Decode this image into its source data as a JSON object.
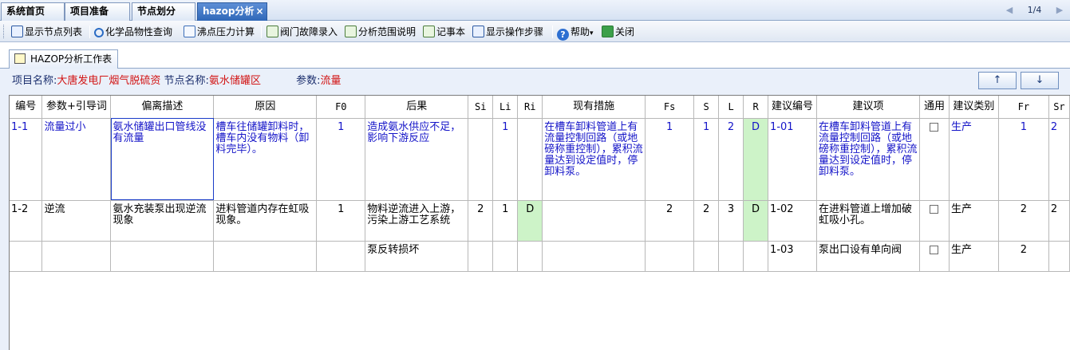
{
  "tabs": [
    {
      "label": "系统首页"
    },
    {
      "label": "项目准备"
    },
    {
      "label": "节点划分"
    },
    {
      "label": "hazop分析",
      "close": "×"
    }
  ],
  "pager": {
    "prev": "◀",
    "page": "1/4",
    "next": "▶"
  },
  "toolbar": {
    "show_nodes": "显示节点列表",
    "chem_query": "化学品物性查询",
    "boiling_calc": "沸点压力计算",
    "valve_fault": "阀门故障录入",
    "scope_desc": "分析范围说明",
    "notebook": "记事本",
    "show_steps": "显示操作步骤",
    "help": "帮助",
    "help_caret": "▾",
    "close": "关闭"
  },
  "panel": {
    "tab_label": "HAZOP分析工作表"
  },
  "info": {
    "project_label": "项目名称:",
    "project_value": "大唐发电厂烟气脱硫资",
    "node_label": "节点名称:",
    "node_value": "氨水储罐区",
    "param_label": "参数:",
    "param_value": "流量"
  },
  "nav": {
    "up": "↑",
    "down": "↓"
  },
  "grid": {
    "headers": [
      "编号",
      "参数+引导词",
      "偏离描述",
      "原因",
      "F0",
      "后果",
      "Si",
      "Li",
      "Ri",
      "现有措施",
      "Fs",
      "S",
      "L",
      "R",
      "建议编号",
      "建议项",
      "通用",
      "建议类别",
      "Fr",
      "Sr"
    ],
    "rows": [
      {
        "id": "1-1",
        "param": "流量过小",
        "deviation": "氨水储罐出口管线没有流量",
        "cause": "槽车往储罐卸料时，槽车内没有物料（卸料完毕）。",
        "f0": "1",
        "consequence": "造成氨水供应不足，影响下游反应",
        "si": "",
        "li": "1",
        "ri": "",
        "measures": "在槽车卸料管道上有流量控制回路（或地磅称重控制），累积流量达到设定值时，停卸料泵。",
        "fs": "1",
        "s": "1",
        "l": "2",
        "r": "D",
        "sug_id": "1-01",
        "suggestion": "在槽车卸料管道上有流量控制回路（或地磅称重控制），累积流量达到设定值时，停卸料泵。",
        "category": "生产",
        "fr": "1",
        "sr": "2"
      },
      {
        "id": "1-2",
        "param": "逆流",
        "deviation": "氨水充装泵出现逆流现象",
        "cause": "进料管道内存在虹吸现象。",
        "f0": "1",
        "consequence": "物料逆流进入上游，污染上游工艺系统",
        "si": "2",
        "li": "1",
        "ri": "D",
        "measures": "",
        "fs": "2",
        "s": "2",
        "l": "3",
        "r": "D",
        "sug_id": "1-02",
        "suggestion": "在进料管道上增加破虹吸小孔。",
        "category": "生产",
        "fr": "2",
        "sr": "2"
      },
      {
        "consequence": "泵反转损坏",
        "sug_id": "1-03",
        "suggestion": "泵出口设有单向阀",
        "category": "生产",
        "fr": "2"
      }
    ]
  },
  "colors": {
    "accent": "#2f67b8",
    "highlight_green": "#cdf3c8",
    "link_blue": "#1414c8",
    "info_red": "#d21414"
  }
}
